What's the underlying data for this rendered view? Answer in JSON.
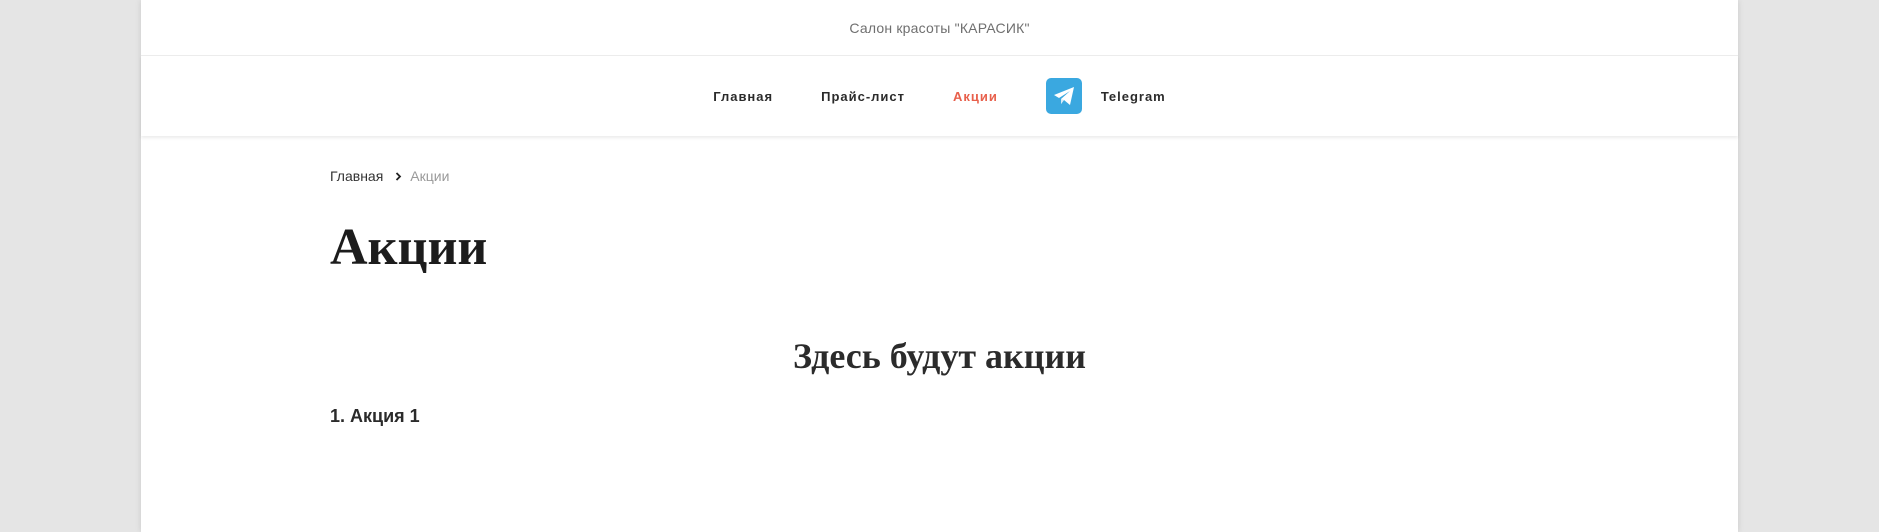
{
  "header": {
    "site_name": "Салон красоты \"КАРАСИК\""
  },
  "nav": {
    "items": [
      {
        "label": "Главная"
      },
      {
        "label": "Прайс-лист"
      },
      {
        "label": "Акции"
      },
      {
        "label": "Telegram",
        "icon": "telegram-icon"
      }
    ],
    "active_index": 2,
    "active_color": "#e8604c",
    "telegram_color": "#3aa8e0"
  },
  "breadcrumb": {
    "home_label": "Главная",
    "current_label": "Акции"
  },
  "main": {
    "title": "Акции",
    "section_heading": "Здесь будут акции",
    "promo_item": "1. Акция 1"
  }
}
